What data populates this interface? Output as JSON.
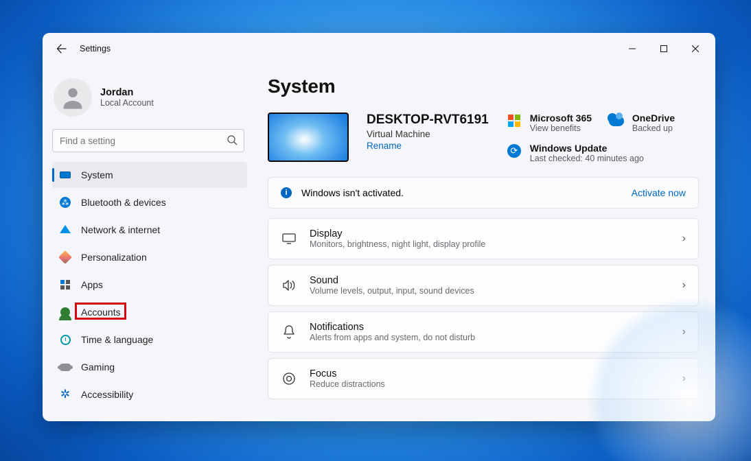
{
  "window": {
    "title": "Settings"
  },
  "profile": {
    "name": "Jordan",
    "subtitle": "Local Account"
  },
  "search": {
    "placeholder": "Find a setting"
  },
  "nav": {
    "items": [
      {
        "label": "System"
      },
      {
        "label": "Bluetooth & devices"
      },
      {
        "label": "Network & internet"
      },
      {
        "label": "Personalization"
      },
      {
        "label": "Apps"
      },
      {
        "label": "Accounts"
      },
      {
        "label": "Time & language"
      },
      {
        "label": "Gaming"
      },
      {
        "label": "Accessibility"
      }
    ]
  },
  "page": {
    "heading": "System",
    "pc": {
      "name": "DESKTOP-RVT6191",
      "subtitle": "Virtual Machine",
      "rename": "Rename"
    },
    "tiles": {
      "m365": {
        "title": "Microsoft 365",
        "sub": "View benefits"
      },
      "onedrive": {
        "title": "OneDrive",
        "sub": "Backed up"
      },
      "update": {
        "title": "Windows Update",
        "sub": "Last checked: 40 minutes ago"
      }
    },
    "banner": {
      "text": "Windows isn't activated.",
      "action": "Activate now"
    },
    "rows": [
      {
        "title": "Display",
        "sub": "Monitors, brightness, night light, display profile"
      },
      {
        "title": "Sound",
        "sub": "Volume levels, output, input, sound devices"
      },
      {
        "title": "Notifications",
        "sub": "Alerts from apps and system, do not disturb"
      },
      {
        "title": "Focus",
        "sub": "Reduce distractions"
      }
    ]
  },
  "annotation": {
    "target": "Accounts"
  }
}
